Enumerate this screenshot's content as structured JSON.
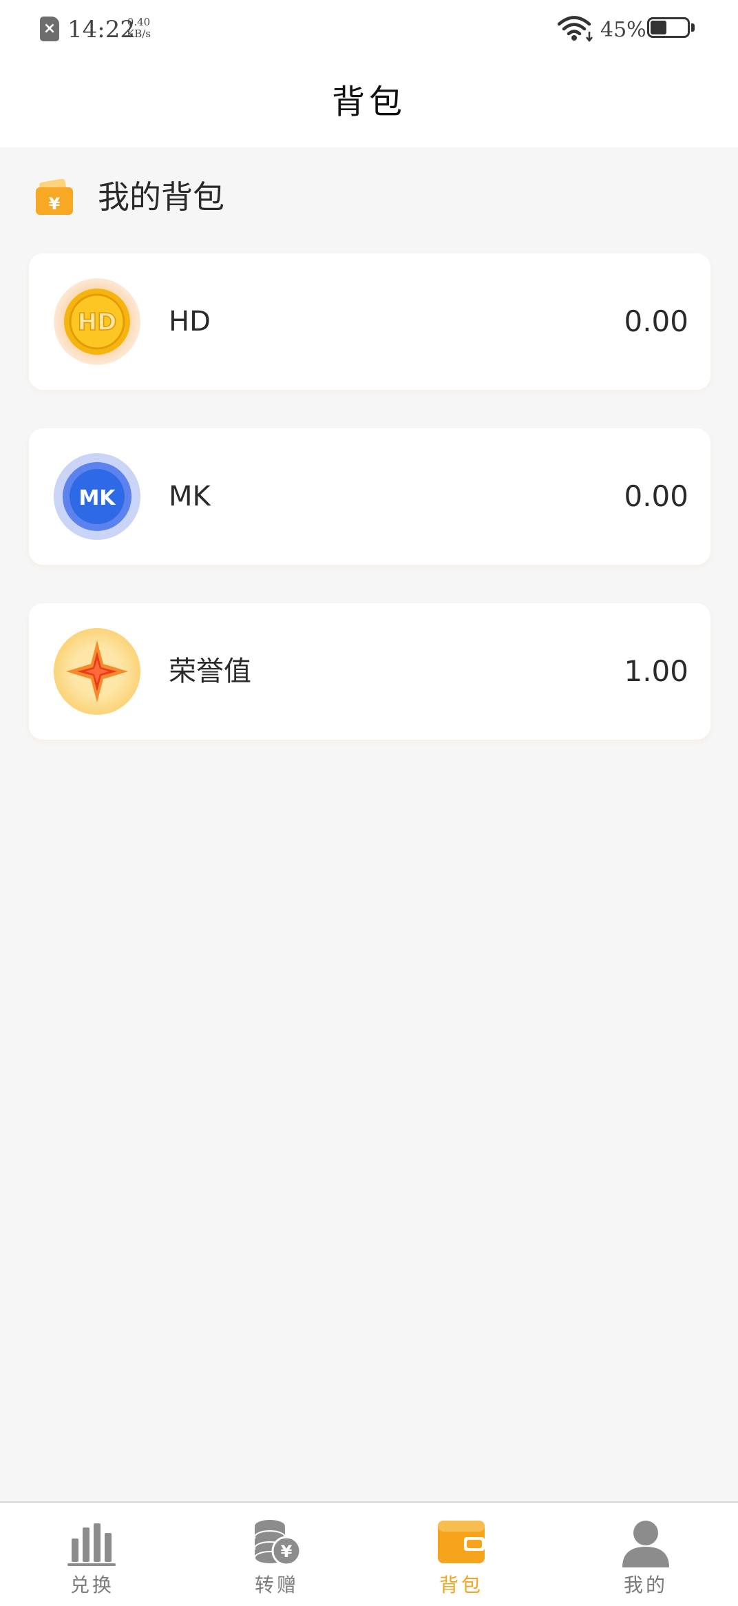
{
  "status_bar": {
    "sim_icon": "sim-card-error-icon",
    "time": "14:22",
    "net_speed_value": "0.40",
    "net_speed_unit": "KB/s",
    "wifi_icon": "wifi-icon",
    "battery_percent_text": "45%",
    "battery_level": 0.45
  },
  "header": {
    "title": "背包"
  },
  "section": {
    "icon": "wallet-icon",
    "title": "我的背包"
  },
  "items": [
    {
      "name": "HD",
      "value": "0.00",
      "icon": "hd-coin-icon",
      "icon_text": "HD"
    },
    {
      "name": "MK",
      "value": "0.00",
      "icon": "mk-coin-icon",
      "icon_text": "MK"
    },
    {
      "name": "荣誉值",
      "value": "1.00",
      "icon": "honor-star-icon"
    }
  ],
  "bottom_nav": {
    "items": [
      {
        "label": "兑换",
        "icon": "bar-chart-icon",
        "active": false
      },
      {
        "label": "转赠",
        "icon": "coins-transfer-icon",
        "active": false
      },
      {
        "label": "背包",
        "icon": "wallet-icon",
        "active": true
      },
      {
        "label": "我的",
        "icon": "user-icon",
        "active": false
      }
    ]
  },
  "colors": {
    "accent": "#f5a41c",
    "background": "#f6f6f6",
    "card": "#ffffff",
    "nav_inactive": "#7a7a7a"
  }
}
